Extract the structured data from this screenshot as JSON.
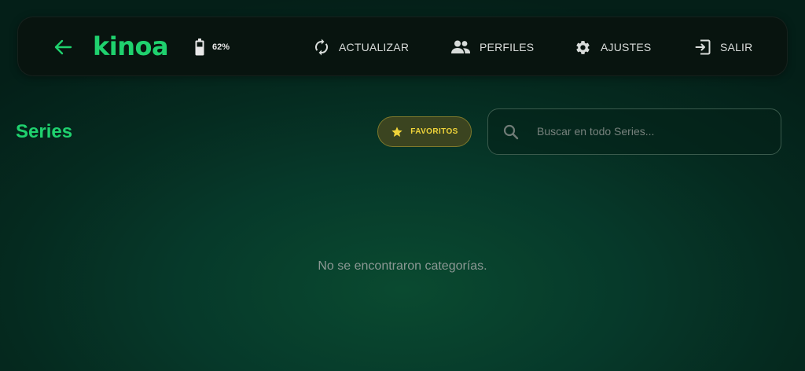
{
  "header": {
    "logo_text": "kinoa",
    "battery_level": "62%",
    "nav": {
      "refresh_label": "ACTUALIZAR",
      "profiles_label": "PERFILES",
      "settings_label": "AJUSTES",
      "logout_label": "SALIR"
    },
    "icons": {
      "back": "arrow-left-icon",
      "battery": "battery-icon",
      "refresh": "refresh-icon",
      "profiles": "people-icon",
      "settings": "gear-icon",
      "logout": "exit-icon"
    }
  },
  "page": {
    "title": "Series",
    "favorites_label": "FAVORITOS",
    "search_placeholder": "Buscar en todo Series...",
    "search_value": "",
    "empty_message": "No se encontraron categorías."
  },
  "colors": {
    "accent": "#1fd16e",
    "favorites": "#f0d43a",
    "header_bg": "#08140f",
    "background": "#06392a"
  }
}
